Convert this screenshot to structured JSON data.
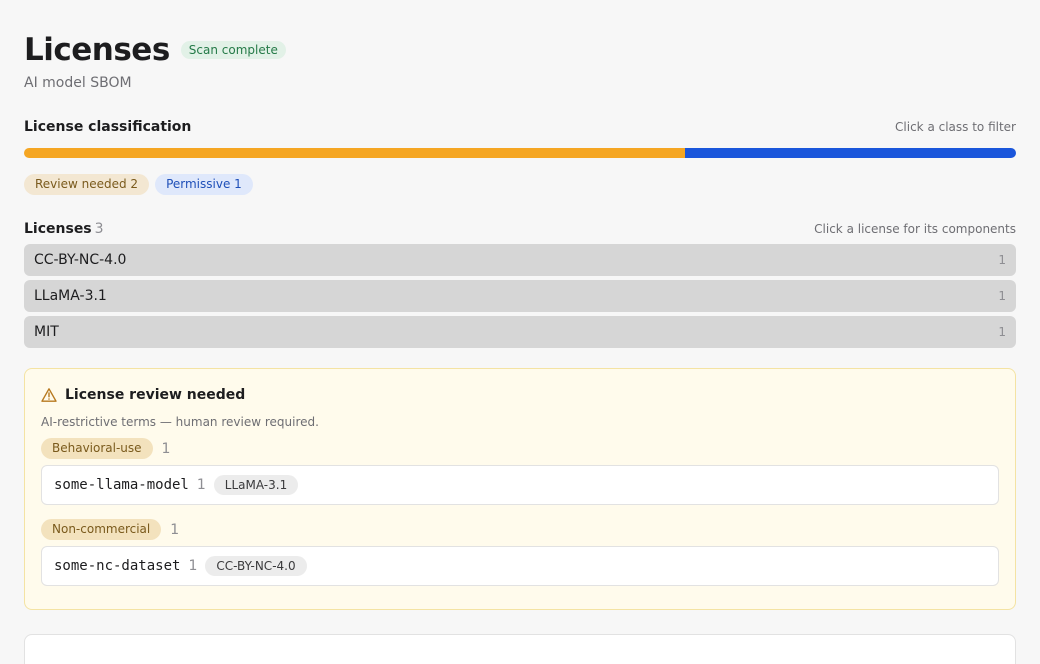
{
  "header": {
    "title": "Licenses",
    "status": "Scan complete",
    "subtitle": "AI model SBOM"
  },
  "classification": {
    "title": "License classification",
    "hint": "Click a class to filter",
    "review_fraction": 0.6667,
    "permissive_fraction": 0.3333,
    "colors": {
      "review": "#f5a623",
      "permissive": "#1a56db"
    },
    "chips": [
      {
        "label": "Review needed 2"
      },
      {
        "label": "Permissive 1"
      }
    ]
  },
  "licenses": {
    "title": "Licenses",
    "count": "3",
    "hint": "Click a license for its components",
    "items": [
      {
        "name": "CC-BY-NC-4.0",
        "count": "1"
      },
      {
        "name": "LLaMA-3.1",
        "count": "1"
      },
      {
        "name": "MIT",
        "count": "1"
      }
    ]
  },
  "review": {
    "icon": "warning-triangle-icon",
    "title": "License review needed",
    "description": "AI-restrictive terms — human review required.",
    "groups": [
      {
        "tag": "Behavioral-use",
        "count": "1",
        "component": {
          "name": "some-llama-model",
          "count": "1",
          "license": "LLaMA-3.1"
        }
      },
      {
        "tag": "Non-commercial",
        "count": "1",
        "component": {
          "name": "some-nc-dataset",
          "count": "1",
          "license": "CC-BY-NC-4.0"
        }
      }
    ]
  }
}
